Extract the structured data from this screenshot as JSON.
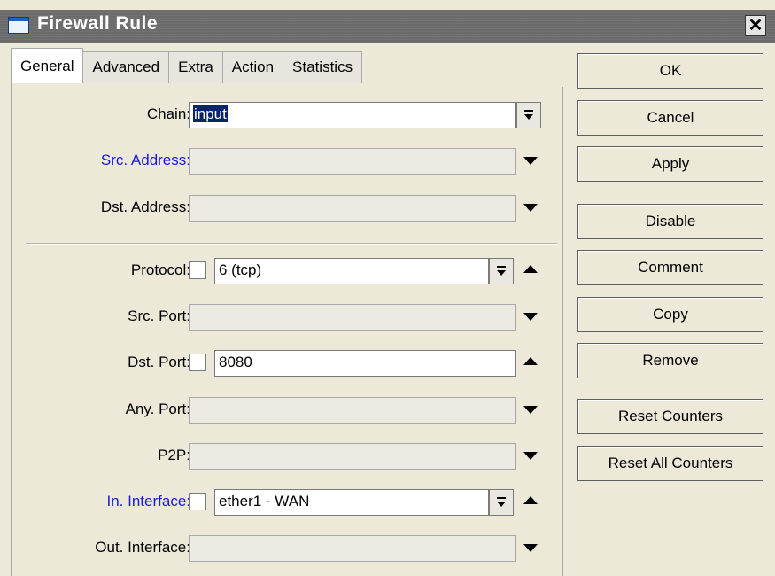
{
  "window": {
    "title": "Firewall Rule",
    "close_glyph": "✕"
  },
  "tabs": [
    "General",
    "Advanced",
    "Extra",
    "Action",
    "Statistics"
  ],
  "active_tab": "General",
  "form": {
    "chain": {
      "label": "Chain:",
      "value": "input"
    },
    "src_address": {
      "label": "Src. Address:",
      "value": ""
    },
    "dst_address": {
      "label": "Dst. Address:",
      "value": ""
    },
    "protocol": {
      "label": "Protocol:",
      "value": "6 (tcp)",
      "negate": false
    },
    "src_port": {
      "label": "Src. Port:",
      "value": ""
    },
    "dst_port": {
      "label": "Dst. Port:",
      "value": "8080",
      "negate": false
    },
    "any_port": {
      "label": "Any. Port:",
      "value": ""
    },
    "p2p": {
      "label": "P2P:",
      "value": ""
    },
    "in_interface": {
      "label": "In. Interface:",
      "value": "ether1 - WAN",
      "negate": false
    },
    "out_interface": {
      "label": "Out. Interface:",
      "value": ""
    }
  },
  "buttons": {
    "ok": "OK",
    "cancel": "Cancel",
    "apply": "Apply",
    "disable": "Disable",
    "comment": "Comment",
    "copy": "Copy",
    "remove": "Remove",
    "reset_counters": "Reset Counters",
    "reset_all_counters": "Reset All Counters"
  },
  "colors": {
    "titlebar": "#6b6b6b",
    "highlight_label": "#1a1ae0",
    "selection": "#0a246a"
  }
}
